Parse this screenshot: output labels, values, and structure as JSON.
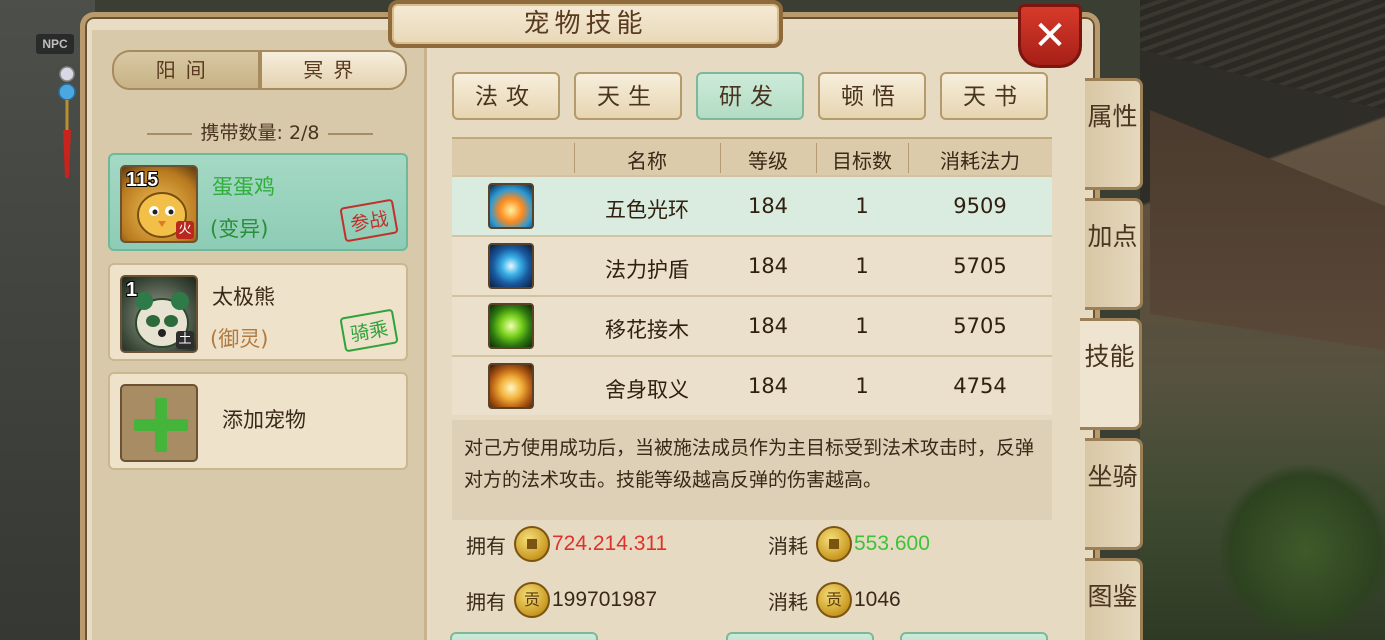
{
  "npc_tag": "NPC",
  "window_title": "宠物技能",
  "close_label": "✕",
  "realm_tabs": [
    "阳间",
    "冥界"
  ],
  "carry_count": {
    "label": "携带数量:",
    "value": "2/8"
  },
  "pets": [
    {
      "level": "115",
      "name": "蛋蛋鸡",
      "type": "(变异)",
      "stamp": "参战",
      "element": "火",
      "name_color": "#2fae3a",
      "stamp_color": "#c2302a",
      "selected": true
    },
    {
      "level": "1",
      "name": "太极熊",
      "type": "(御灵)",
      "stamp": "骑乘",
      "element": "土",
      "name_color": "#3a2818",
      "stamp_color": "#2fa23a",
      "selected": false
    }
  ],
  "add_pet_label": "添加宠物",
  "skill_categories": [
    {
      "label": "法攻",
      "active": false
    },
    {
      "label": "天生",
      "active": false
    },
    {
      "label": "研发",
      "active": true
    },
    {
      "label": "顿悟",
      "active": false
    },
    {
      "label": "天书",
      "active": false
    }
  ],
  "skill_table": {
    "headers": [
      "名称",
      "等级",
      "目标数",
      "消耗法力"
    ],
    "rows": [
      {
        "icon": "rainbow-ring-icon",
        "name": "五色光环",
        "level": "184",
        "targets": "1",
        "mana": "9509",
        "selected": true
      },
      {
        "icon": "mana-shield-icon",
        "name": "法力护盾",
        "level": "184",
        "targets": "1",
        "mana": "5705",
        "selected": false
      },
      {
        "icon": "flower-graft-icon",
        "name": "移花接木",
        "level": "184",
        "targets": "1",
        "mana": "5705",
        "selected": false
      },
      {
        "icon": "self-sacrifice-icon",
        "name": "舍身取义",
        "level": "184",
        "targets": "1",
        "mana": "4754",
        "selected": false
      }
    ]
  },
  "description": "对己方使用成功后，当被施法成员作为主目标受到法术攻击时，反弹对方的法术攻击。技能等级越高反弹的伤害越高。",
  "resources": {
    "owned_label": "拥有",
    "cost_label": "消耗",
    "money_owned": "724.214.311",
    "money_cost": "553.600",
    "contrib_owned": "199701987",
    "contrib_cost": "1046",
    "contrib_glyph": "贡",
    "money_owned_color": "#e0312a",
    "money_cost_color": "#3fc23a"
  },
  "side_tabs": [
    {
      "label": "属性",
      "active": false
    },
    {
      "label": "加点",
      "active": false
    },
    {
      "label": "技能",
      "active": true
    },
    {
      "label": "坐骑",
      "active": false
    },
    {
      "label": "图鉴",
      "active": false
    }
  ]
}
